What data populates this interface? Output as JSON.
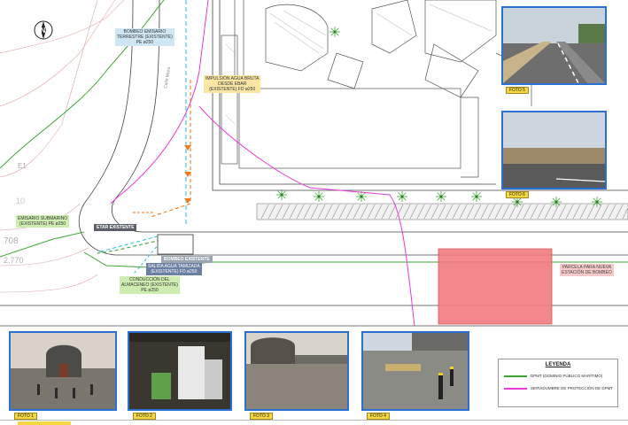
{
  "labels": {
    "bombeo_emisario": "BOMBEO EMISARIO\nTERRESTRE (EXISTENTE)\nPE ø250",
    "impulsion": "IMPULSIÓN AGUA BRUTA\nDESDE EBAR\n(EXISTENTE) FD ø250",
    "emisario_submarino": "EMISARIO SUBMARINO\n(EXISTENTE) PE ø250",
    "etar": "ETAR EXISTENTE",
    "bombeo_existente": "BOMBEO EXISTENTE",
    "salida_agua": "SALIDA AGUA TAMIZADA\n(EXISTENTE) FD ø250",
    "conduccion": "CONDUCCIÓN DEL\nALMACENEO (EXISTENTE)\nPE ø250",
    "parcela": "PARCELA PARA NUEVA\nESTACIÓN DE BOMBEO",
    "calle": "Calle Mara"
  },
  "map_text": {
    "e1": "E1",
    "n708": "708",
    "n2770": "2.770",
    "n10": "10"
  },
  "photos": {
    "foto1": "FOTO 1",
    "foto2": "FOTO 2",
    "foto3": "FOTO 3",
    "foto4": "FOTO 4",
    "foto5": "FOTO 5",
    "foto6": "FOTO 6"
  },
  "legend": {
    "title": "LEYENDA",
    "items": [
      {
        "label": "DPMT (DOMINIO PÚBLICO MARÍTIMO)",
        "color": "#3fa535"
      },
      {
        "label": "SERVIDUMBRE DE PROTECCIÓN DE DPMT",
        "color": "#e83ad8"
      }
    ]
  },
  "colors": {
    "dpmt": "#3fa535",
    "servidumbre": "#e83ad8",
    "pipe_cyan": "#35c6e0",
    "pipe_orange": "#f07a1e",
    "parcela_fill": "#f27c80",
    "photo_border": "#2b6fd0"
  },
  "icons": {
    "north": "north-arrow-icon",
    "tree": "palm-tree-icon"
  }
}
